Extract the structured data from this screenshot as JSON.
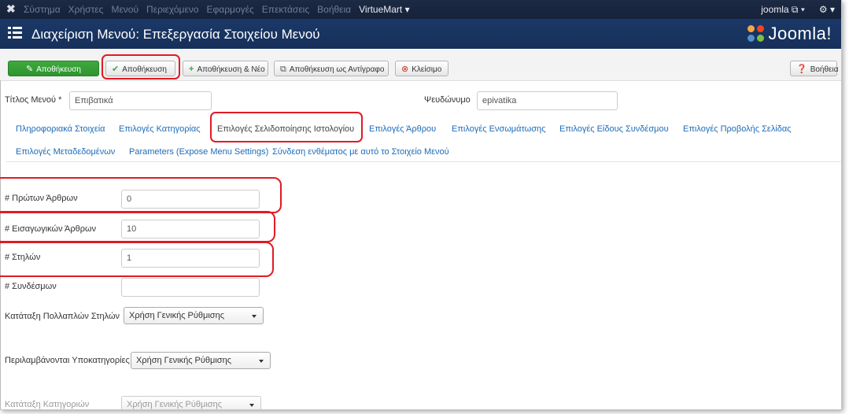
{
  "topbar": {
    "menu": [
      "Σύστημα",
      "Χρήστες",
      "Μενού",
      "Περιεχόμενο",
      "Εφαρμογές",
      "Επεκτάσεις",
      "Βοήθεια",
      "VirtueMart ▾"
    ],
    "user": "joomla ⧉ ▾",
    "settings": "⚙ ▾"
  },
  "header": {
    "title": "Διαχείριση Μενού: Επεξεργασία Στοιχείου Μενού",
    "brand": "Joomla!"
  },
  "toolbar": {
    "save": "Αποθήκευση",
    "save_close": "Αποθήκευση",
    "save_new": "Αποθήκευση & Νέο",
    "save_copy": "Αποθήκευση ως Αντίγραφο",
    "close": "Κλείσιμο",
    "help": "Βοήθεια"
  },
  "form": {
    "title_label": "Τίτλος Μενού *",
    "title_value": "Επιβατικά",
    "alias_label": "Ψευδώνυμο",
    "alias_value": "epivatika"
  },
  "tabs": [
    "Πληροφοριακά Στοιχεία",
    "Επιλογές Κατηγορίας",
    "Επιλογές Σελιδοποίησης Ιστολογίου",
    "Επιλογές Άρθρου",
    "Επιλογές Ενσωμάτωσης",
    "Επιλογές Είδους Συνδέσμου",
    "Επιλογές Προβολής Σελίδας",
    "Επιλογές Μεταδεδομένων",
    "Parameters (Expose Menu Settings)",
    "Σύνδεση ενθέματος με αυτό το Στοιχείο Μενού"
  ],
  "fields": {
    "leading_label": "# Πρώτων Άρθρων",
    "leading_value": "0",
    "intro_label": "# Εισαγωγικών Άρθρων",
    "intro_value": "10",
    "columns_label": "# Στηλών",
    "columns_value": "1",
    "links_label": "# Συνδέσμων",
    "links_value": "",
    "multicolumn_label": "Κατάταξη Πολλαπλών Στηλών",
    "multicolumn_value": "Χρήση Γενικής Ρύθμισης",
    "subcats_label": "Περιλαμβάνονται Υποκατηγορίες",
    "subcats_value": "Χρήση Γενικής Ρύθμισης",
    "catorder_label": "Κατάταξη Κατηγοριών",
    "catorder_value": "Χρήση Γενικής Ρύθμισης"
  },
  "colors": {
    "navbar": "#1d2a44",
    "header": "#17305a",
    "link": "#1e6bb8",
    "highlight": "#e01b24",
    "save_green": "#3daa3d"
  }
}
